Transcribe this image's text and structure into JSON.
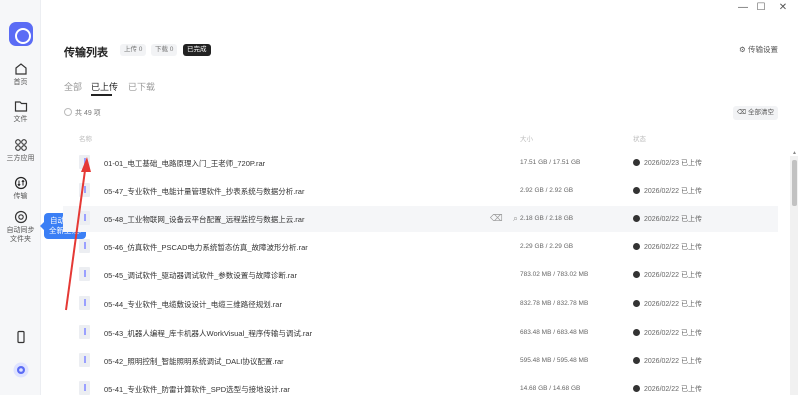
{
  "window": {
    "minimize": "—",
    "maximize": "☐",
    "close": "✕"
  },
  "sidebar": {
    "items": [
      {
        "label": "首页",
        "icon": "home-icon"
      },
      {
        "label": "文件",
        "icon": "folder-icon"
      },
      {
        "label": "三方应用",
        "icon": "apps-icon"
      },
      {
        "label": "传输",
        "icon": "transfer-icon"
      },
      {
        "label": "自动同步",
        "label2": "文件夹",
        "icon": "sync-icon"
      }
    ],
    "device_icon": "phone-icon"
  },
  "tooltip": {
    "line1": "自动同步",
    "line2": "全新上线!"
  },
  "header": {
    "title": "传输列表",
    "pills": [
      "上传 0",
      "下载 0",
      "已完成"
    ],
    "settings": "传输设置"
  },
  "tabs": [
    "全部",
    "已上传",
    "已下载"
  ],
  "count": "共 49 项",
  "clear_all": "全部清空",
  "columns": {
    "name": "名称",
    "size": "大小",
    "status": "状态"
  },
  "files": [
    {
      "name": "01-01_电工基础_电路原理入门_王老师_720P.rar",
      "size": "17.51 GB / 17.51 GB",
      "date": "2026/02/23",
      "status": "已上传"
    },
    {
      "name": "05-47_专业软件_电能计量管理软件_抄表系统与数据分析.rar",
      "size": "2.92 GB / 2.92 GB",
      "date": "2026/02/22",
      "status": "已上传"
    },
    {
      "name": "05-48_工业物联网_设备云平台配置_远程监控与数据上云.rar",
      "size": "2.18 GB / 2.18 GB",
      "date": "2026/02/22",
      "status": "已上传"
    },
    {
      "name": "05-46_仿真软件_PSCAD电力系统暂态仿真_故障波形分析.rar",
      "size": "2.29 GB / 2.29 GB",
      "date": "2026/02/22",
      "status": "已上传"
    },
    {
      "name": "05-45_调试软件_驱动器调试软件_参数设置与故障诊断.rar",
      "size": "783.02 MB / 783.02 MB",
      "date": "2026/02/22",
      "status": "已上传"
    },
    {
      "name": "05-44_专业软件_电缆敷设设计_电缆三维路径规划.rar",
      "size": "832.78 MB / 832.78 MB",
      "date": "2026/02/22",
      "status": "已上传"
    },
    {
      "name": "05-43_机器人编程_库卡机器人WorkVisual_程序传输与调试.rar",
      "size": "683.48 MB / 683.48 MB",
      "date": "2026/02/22",
      "status": "已上传"
    },
    {
      "name": "05-42_照明控制_智能照明系统调试_DALI协议配置.rar",
      "size": "595.48 MB / 595.48 MB",
      "date": "2026/02/22",
      "status": "已上传"
    },
    {
      "name": "05-41_专业软件_防雷计算软件_SPD选型与接地设计.rar",
      "size": "14.68 GB / 14.68 GB",
      "date": "2026/02/22",
      "status": "已上传"
    }
  ]
}
